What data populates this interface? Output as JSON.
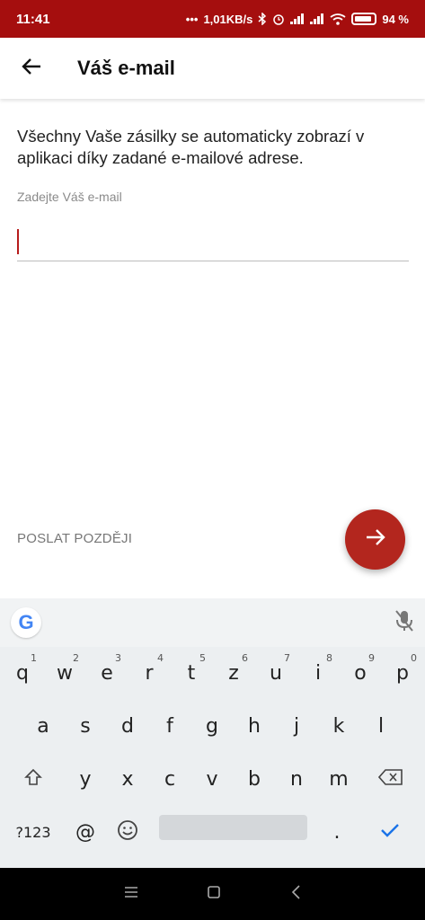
{
  "status_bar": {
    "time": "11:41",
    "speed": "1,01KB/s",
    "battery": "94 %"
  },
  "header": {
    "title": "Váš e-mail"
  },
  "main": {
    "description": "Všechny Vaše zásilky se automaticky zobrazí v aplikaci díky zadané e-mailové adrese.",
    "email_label": "Zadejte Váš e-mail",
    "email_value": "",
    "later_label": "POSLAT POZDĚJI"
  },
  "keyboard": {
    "row1": [
      {
        "k": "q",
        "n": "1"
      },
      {
        "k": "w",
        "n": "2"
      },
      {
        "k": "e",
        "n": "3"
      },
      {
        "k": "r",
        "n": "4"
      },
      {
        "k": "t",
        "n": "5"
      },
      {
        "k": "z",
        "n": "6"
      },
      {
        "k": "u",
        "n": "7"
      },
      {
        "k": "i",
        "n": "8"
      },
      {
        "k": "o",
        "n": "9"
      },
      {
        "k": "p",
        "n": "0"
      }
    ],
    "row2": [
      "a",
      "s",
      "d",
      "f",
      "g",
      "h",
      "j",
      "k",
      "l"
    ],
    "row3": [
      "y",
      "x",
      "c",
      "v",
      "b",
      "n",
      "m"
    ],
    "row4": {
      "symbols": "?123",
      "at": "@",
      "period": "."
    }
  },
  "icons": [
    "back-arrow-icon",
    "arrow-right-icon",
    "google-icon",
    "mic-off-icon",
    "shift-icon",
    "backspace-icon",
    "emoji-icon",
    "check-icon",
    "menu-icon",
    "home-icon",
    "back-nav-icon"
  ],
  "colors": {
    "brand": "#a50e0e",
    "fab": "#b3261e"
  }
}
